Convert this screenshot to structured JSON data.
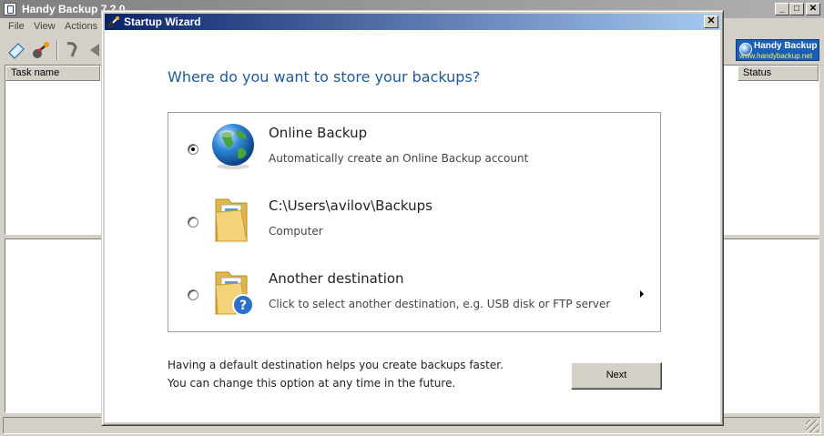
{
  "main_window": {
    "title": "Handy Backup 7.2.0",
    "menu": [
      "File",
      "View",
      "Actions"
    ],
    "columns": {
      "task_name": "Task name",
      "status": "Status"
    },
    "logo": {
      "title": "Handy Backup",
      "url": "www.handybackup.net"
    }
  },
  "dialog": {
    "title": "Startup Wizard",
    "close_label": "✕",
    "heading": "Where do you want to store your backups?",
    "options": [
      {
        "title": "Online Backup",
        "description": "Automatically create an Online Backup account",
        "icon": "globe-icon",
        "selected": true
      },
      {
        "title": "C:\\Users\\avilov\\Backups",
        "description": "Computer",
        "icon": "folder-icon",
        "selected": false
      },
      {
        "title": "Another destination",
        "description": "Click to select another destination, e.g. USB disk or FTP server",
        "icon": "folder-question-icon",
        "selected": false
      }
    ],
    "footer_line1": "Having a default destination helps you create backups faster.",
    "footer_line2": "You can change this option at any time in the future.",
    "next_label": "Next"
  },
  "colors": {
    "heading": "#1f5a9a",
    "titlebar_active": "#0a246a",
    "logo_bg": "#1a5fb4"
  }
}
